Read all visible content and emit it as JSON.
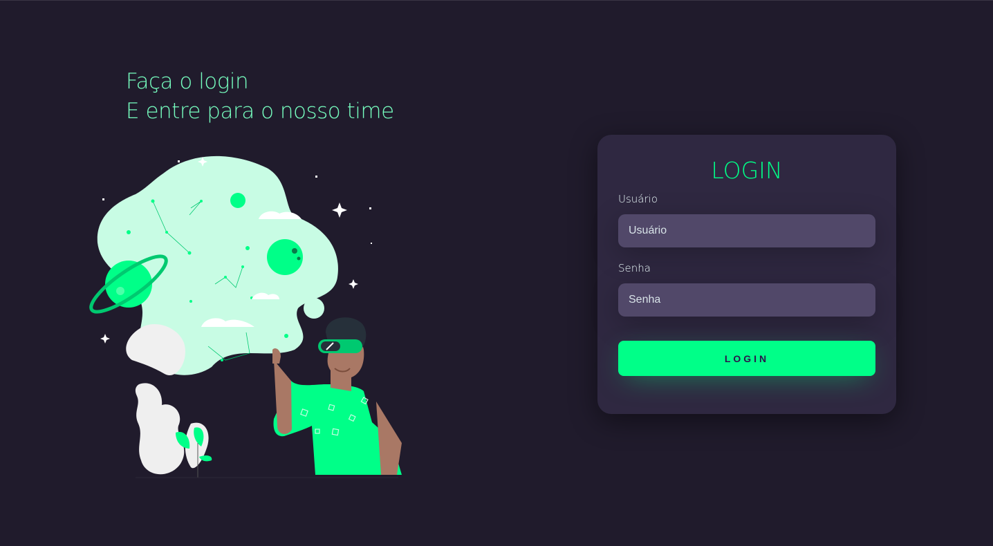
{
  "left": {
    "heading_line1": "Faça o login",
    "heading_line2": "E entre para o nosso time",
    "illustration_icon": "person-vr-space-illustration"
  },
  "login_card": {
    "title": "LOGIN",
    "username": {
      "label": "Usuário",
      "placeholder": "Usuário",
      "value": ""
    },
    "password": {
      "label": "Senha",
      "placeholder": "Senha",
      "value": ""
    },
    "submit_label": "LOGIN"
  },
  "colors": {
    "background": "#201b2c",
    "card": "#2f2841",
    "input": "#514869",
    "accent": "#00ff88",
    "heading": "#77ffc0"
  }
}
